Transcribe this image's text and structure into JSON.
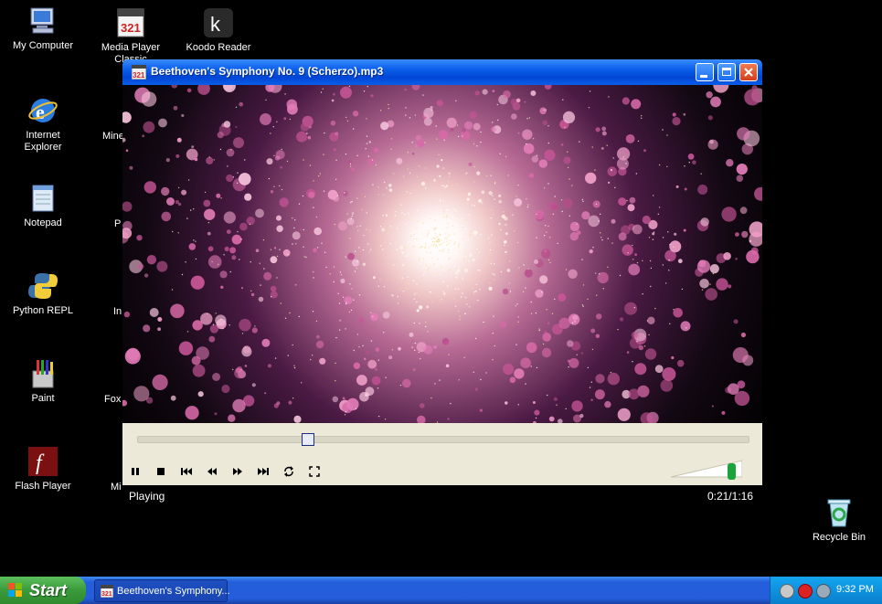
{
  "desktop": {
    "icons": [
      {
        "label": "My Computer",
        "icon": "computer-icon"
      },
      {
        "label": "Media Player Classic",
        "icon": "media-player-icon"
      },
      {
        "label": "Koodo Reader",
        "icon": "koodo-icon"
      },
      {
        "label": "Internet Explorer",
        "icon": "ie-icon"
      },
      {
        "label": "Notepad",
        "icon": "notepad-icon"
      },
      {
        "label": "Python REPL",
        "icon": "python-icon"
      },
      {
        "label": "Paint",
        "icon": "paint-icon"
      },
      {
        "label": "Flash Player",
        "icon": "flash-icon"
      },
      {
        "label": "Recycle Bin",
        "icon": "recycle-bin-icon"
      }
    ],
    "partial_labels": [
      "Mine",
      "P",
      "In",
      "Fox",
      "Mi"
    ]
  },
  "window": {
    "title": "Beethoven's Symphony No. 9 (Scherzo).mp3",
    "status_left": "Playing",
    "status_right": "0:21/1:16",
    "seek_fraction": 0.28,
    "volume_fraction": 0.9
  },
  "taskbar": {
    "start_label": "Start",
    "task_label": "Beethoven's Symphony...",
    "clock": "9:32 PM"
  },
  "colors": {
    "taskbar_blue": "#245edb",
    "start_green": "#3a9a3a",
    "titlebar_blue": "#0a5ee8",
    "volume_green": "#1ba33c"
  }
}
